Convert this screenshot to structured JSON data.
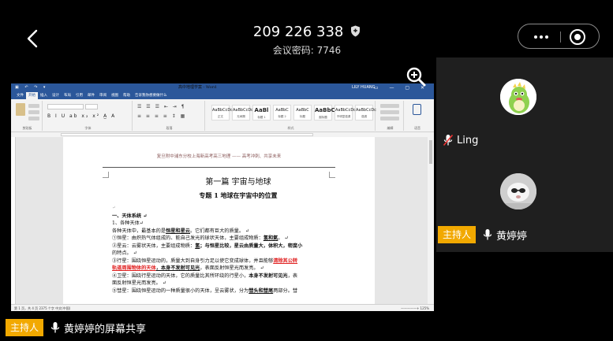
{
  "header": {
    "meeting_id": "209 226 338",
    "meeting_password": "会议密码: 7746"
  },
  "participants": [
    {
      "name": "Ling",
      "muted": true
    },
    {
      "name": "黄婷婷",
      "role_tag": "主持人"
    }
  ],
  "screen_share": {
    "role_tag": "主持人",
    "label": "黄婷婷的屏幕共享"
  },
  "word": {
    "title": "高中地理学案 - Word",
    "user": "LILY HUANG",
    "tabs": [
      "文件",
      "开始",
      "插入",
      "设计",
      "布局",
      "引用",
      "邮件",
      "审阅",
      "视图",
      "帮助",
      "告诉我你想要做什么"
    ],
    "groups": [
      "剪贴板",
      "字体",
      "段落",
      "样式",
      "编辑",
      "语音"
    ],
    "styles": [
      {
        "sample": "AaBbCcDc",
        "name": "正文"
      },
      {
        "sample": "AaBbCcDc",
        "name": "无间隔"
      },
      {
        "sample": "AaBl",
        "name": "标题 1"
      },
      {
        "sample": "AaBbC",
        "name": "标题 2"
      },
      {
        "sample": "AaBbC",
        "name": "标题"
      },
      {
        "sample": "AaBbC",
        "name": "副标题"
      },
      {
        "sample": "AaBbCcDc",
        "name": "不明显强调"
      },
      {
        "sample": "AaBbCcDc",
        "name": "强调"
      }
    ],
    "status_left": "第 1 页，共 4 页   2375 个字   中文(中国)",
    "status_right": "—————+ 125%"
  },
  "document": {
    "header_text": "复旦附中浦东分校上海新高考高三地理 —— 高考冲刺、共享未来",
    "title": "第一篇  宇宙与地球",
    "subtitle": "专题 1  地球在宇宙中的位置",
    "lines": [
      [
        {
          "t": "一、天体系统 ↵",
          "s": "b"
        }
      ],
      [
        {
          "t": "1、各种天体↵",
          "s": ""
        }
      ],
      [
        {
          "t": "各种天体中，最基本的是",
          "s": ""
        },
        {
          "t": "恒星和星云",
          "s": "u"
        },
        {
          "t": "。它们都有巨大的质量。 ↵",
          "s": ""
        }
      ],
      [
        {
          "t": "①恒星：由炽热气体组成的、能自己发光的球状天体，主要组成物质：",
          "s": ""
        },
        {
          "t": "氢和氦",
          "s": "u"
        },
        {
          "t": "。 ↵",
          "s": ""
        }
      ],
      [
        {
          "t": "②星云：云雾状天体，主要组成物质：",
          "s": ""
        },
        {
          "t": "氢",
          "s": "u"
        },
        {
          "t": "；与恒星比较，星云由质量大，体积大，密度小",
          "s": "b"
        }
      ],
      [
        {
          "t": "的特点。 ↵",
          "s": ""
        }
      ],
      [
        {
          "t": "③行星：围绕恒星运动的，质量大到自身引力足以使它变成球体，并且能够",
          "s": ""
        },
        {
          "t": "清除其公转",
          "s": "red"
        }
      ],
      [
        {
          "t": "轨道周围物体的天体",
          "s": "red"
        },
        {
          "t": "，本身不发射可见光",
          "s": "u"
        },
        {
          "t": "，表面反射恒星光而发亮。 ↵",
          "s": ""
        }
      ],
      [
        {
          "t": "④卫星：围绕行星运动的天体，它的质量比其所环绕的行星小，",
          "s": ""
        },
        {
          "t": "本身不发射可见光",
          "s": "b"
        },
        {
          "t": "，表",
          "s": ""
        }
      ],
      [
        {
          "t": "面反射恒星光而发亮。 ↵",
          "s": ""
        }
      ],
      [
        {
          "t": "⑤彗星：围绕恒星运动的一种质量很小的天体，呈云雾状，分为",
          "s": ""
        },
        {
          "t": "彗头和彗尾",
          "s": "u"
        },
        {
          "t": "两部分。彗",
          "s": ""
        }
      ]
    ]
  }
}
